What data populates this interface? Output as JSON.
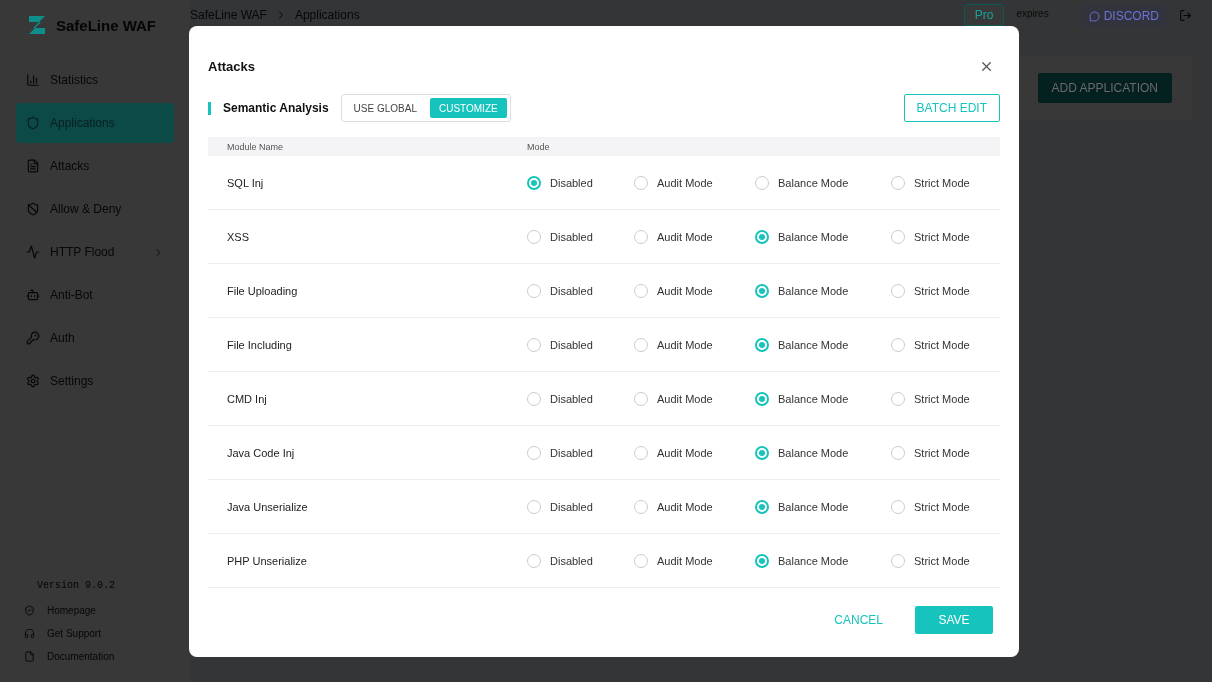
{
  "app": {
    "name": "SafeLine WAF",
    "version": "Version 9.0.2"
  },
  "breadcrumb": [
    "SafeLine WAF",
    "Applications"
  ],
  "header": {
    "pro": "Pro",
    "license": "expires",
    "discord": "DISCORD"
  },
  "sidebar": {
    "items": [
      {
        "label": "Statistics",
        "selected": false
      },
      {
        "label": "Applications",
        "selected": true
      },
      {
        "label": "Attacks",
        "selected": false
      },
      {
        "label": "Allow & Deny",
        "selected": false
      },
      {
        "label": "HTTP Flood",
        "selected": false,
        "expandable": true
      },
      {
        "label": "Anti-Bot",
        "selected": false
      },
      {
        "label": "Auth",
        "selected": false
      },
      {
        "label": "Settings",
        "selected": false
      }
    ],
    "links": [
      "Homepage",
      "Get Support",
      "Documentation"
    ]
  },
  "page": {
    "add_button": "ADD APPLICATION"
  },
  "dialog": {
    "title": "Attacks",
    "section": "Semantic Analysis",
    "toggle": [
      {
        "label": "USE GLOBAL",
        "selected": false
      },
      {
        "label": "CUSTOMIZE",
        "selected": true
      }
    ],
    "batch_edit": "BATCH EDIT",
    "columns": [
      "Module Name",
      "Mode"
    ],
    "rows": [
      {
        "name": "SQL Inj",
        "options": [
          {
            "label": "Disabled",
            "selected": true
          },
          {
            "label": "Audit Mode",
            "selected": false
          },
          {
            "label": "Balance Mode",
            "selected": false
          },
          {
            "label": "Strict Mode",
            "selected": false
          }
        ]
      },
      {
        "name": "XSS",
        "options": [
          {
            "label": "Disabled",
            "selected": false
          },
          {
            "label": "Audit Mode",
            "selected": false
          },
          {
            "label": "Balance Mode",
            "selected": true
          },
          {
            "label": "Strict Mode",
            "selected": false
          }
        ]
      },
      {
        "name": "File Uploading",
        "options": [
          {
            "label": "Disabled",
            "selected": false
          },
          {
            "label": "Audit Mode",
            "selected": false
          },
          {
            "label": "Balance Mode",
            "selected": true
          },
          {
            "label": "Strict Mode",
            "selected": false
          }
        ]
      },
      {
        "name": "File Including",
        "options": [
          {
            "label": "Disabled",
            "selected": false
          },
          {
            "label": "Audit Mode",
            "selected": false
          },
          {
            "label": "Balance Mode",
            "selected": true
          },
          {
            "label": "Strict Mode",
            "selected": false
          }
        ]
      },
      {
        "name": "CMD Inj",
        "options": [
          {
            "label": "Disabled",
            "selected": false
          },
          {
            "label": "Audit Mode",
            "selected": false
          },
          {
            "label": "Balance Mode",
            "selected": true
          },
          {
            "label": "Strict Mode",
            "selected": false
          }
        ]
      },
      {
        "name": "Java Code Inj",
        "options": [
          {
            "label": "Disabled",
            "selected": false
          },
          {
            "label": "Audit Mode",
            "selected": false
          },
          {
            "label": "Balance Mode",
            "selected": true
          },
          {
            "label": "Strict Mode",
            "selected": false
          }
        ]
      },
      {
        "name": "Java Unserialize",
        "options": [
          {
            "label": "Disabled",
            "selected": false
          },
          {
            "label": "Audit Mode",
            "selected": false
          },
          {
            "label": "Balance Mode",
            "selected": true
          },
          {
            "label": "Strict Mode",
            "selected": false
          }
        ]
      },
      {
        "name": "PHP Unserialize",
        "options": [
          {
            "label": "Disabled",
            "selected": false
          },
          {
            "label": "Audit Mode",
            "selected": false
          },
          {
            "label": "Balance Mode",
            "selected": true
          },
          {
            "label": "Strict Mode",
            "selected": false
          }
        ]
      }
    ],
    "cancel": "CANCEL",
    "save": "SAVE"
  }
}
